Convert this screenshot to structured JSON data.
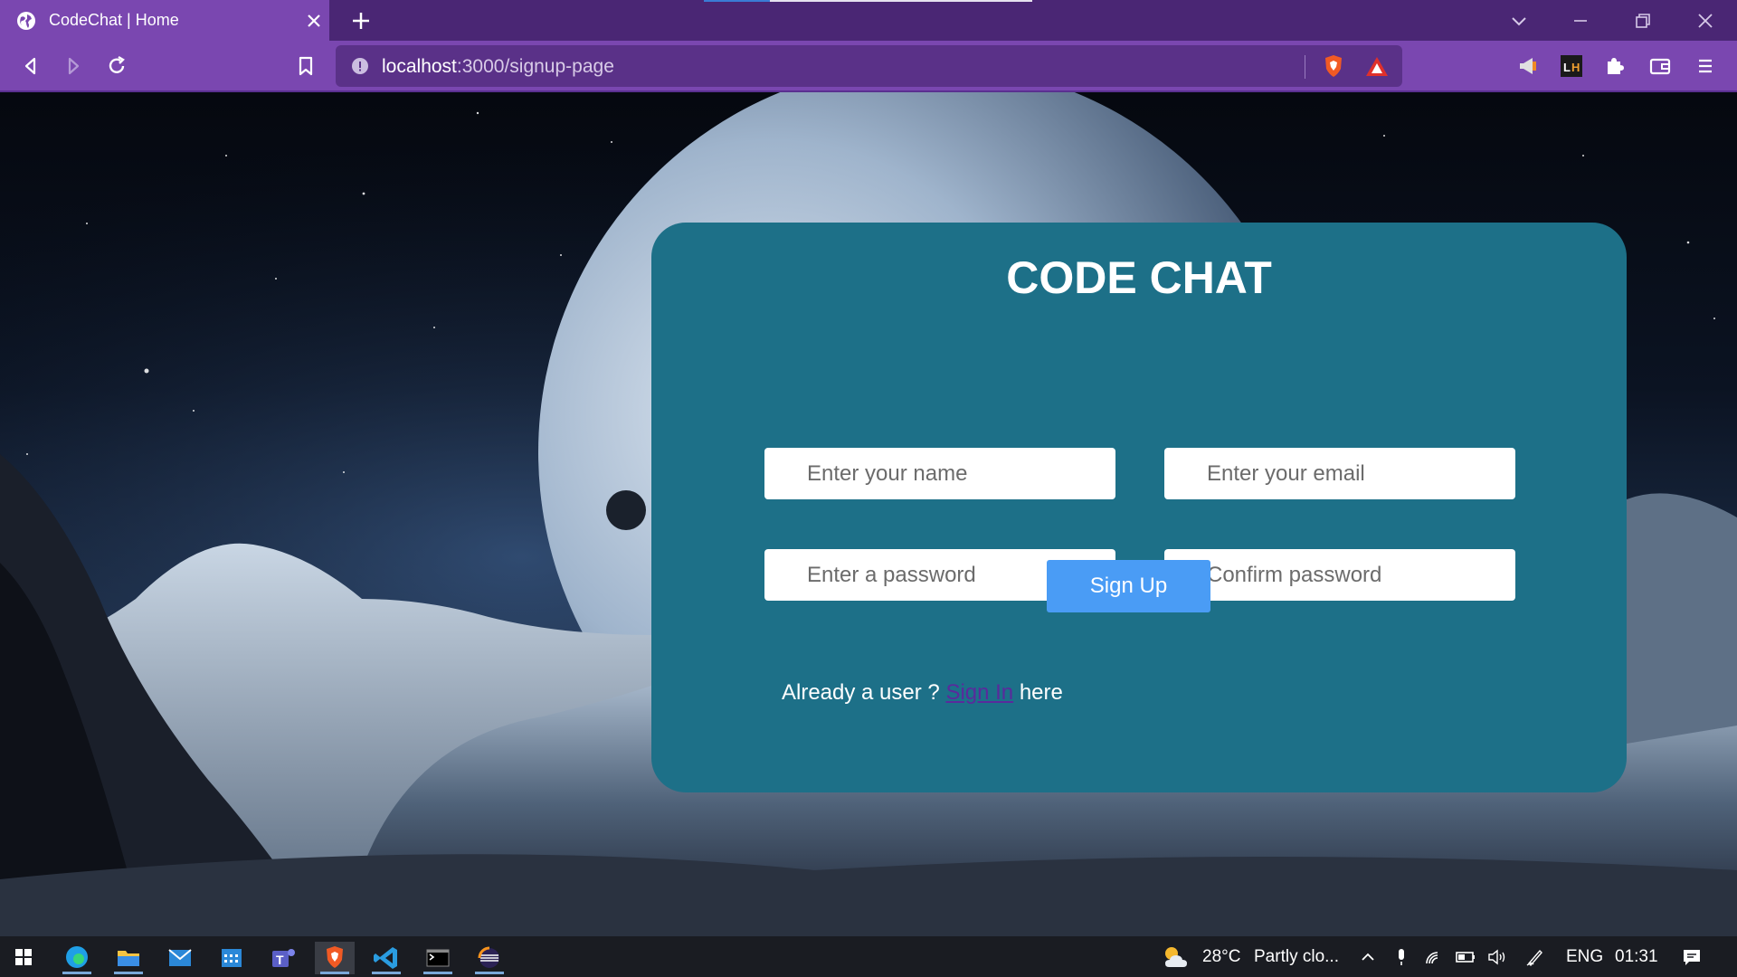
{
  "browser": {
    "tab_title": "CodeChat | Home",
    "url_host": "localhost",
    "url_path": ":3000/signup-page"
  },
  "page": {
    "title": "CODE CHAT",
    "fields": {
      "name_placeholder": "Enter your name",
      "email_placeholder": "Enter your email",
      "password_placeholder": "Enter a password",
      "confirm_placeholder": "Confirm password"
    },
    "signup_label": "Sign Up",
    "signin_prefix": "Already a user ?",
    "signin_link": "Sign In",
    "signin_suffix": "here"
  },
  "taskbar": {
    "weather_temp": "28°C",
    "weather_desc": "Partly clo...",
    "language": "ENG",
    "time": "01:31"
  },
  "colors": {
    "card": "#1d7088",
    "button": "#4a9cf5",
    "browser_chrome": "#7a47b0",
    "tabstrip": "#4a2674"
  }
}
